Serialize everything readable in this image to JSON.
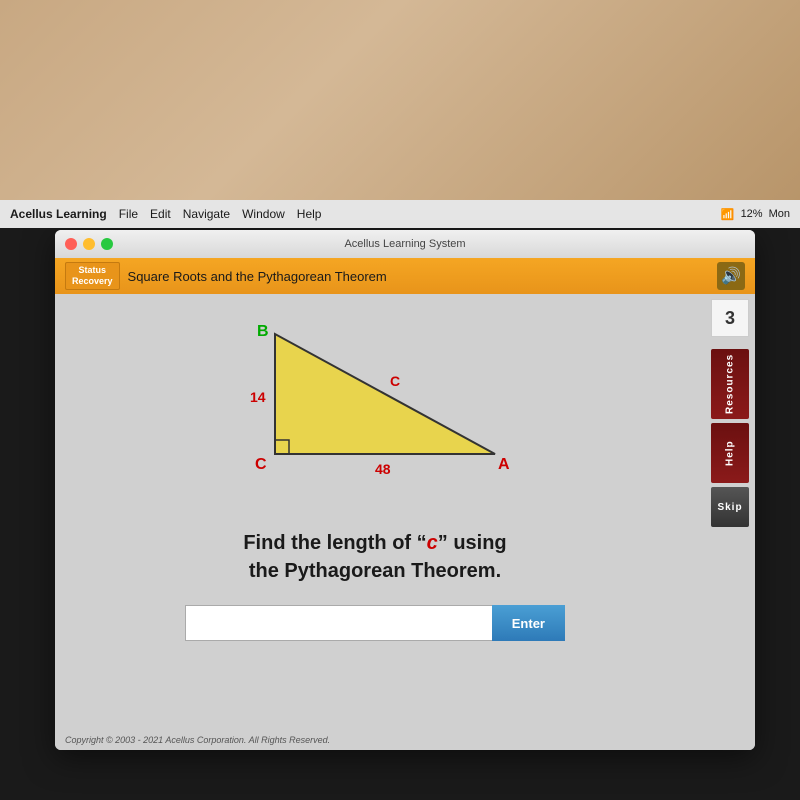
{
  "room": {
    "background_desc": "Room background with warm tan/brown walls"
  },
  "menubar": {
    "app_name": "Acellus Learning",
    "menu_items": [
      "File",
      "Edit",
      "Navigate",
      "Window",
      "Help"
    ],
    "status": "12%",
    "time": "Mon"
  },
  "window": {
    "title": "Acellus Learning System",
    "lesson_title": "Square Roots and the Pythagorean Theorem",
    "status_badge_line1": "Status",
    "status_badge_line2": "Recovery"
  },
  "sidebar": {
    "number": "3",
    "resources_label": "Resources",
    "help_label": "Help",
    "skip_label": "Skip"
  },
  "triangle": {
    "vertex_b": "B",
    "vertex_a": "A",
    "vertex_c": "C",
    "hypotenuse_label": "C",
    "side_14": "14",
    "side_48": "48"
  },
  "question": {
    "line1": "Find the length of “c” using",
    "line2": "the Pythagorean Theorem.",
    "highlight_word": "c"
  },
  "input": {
    "placeholder": "",
    "enter_label": "Enter"
  },
  "copyright": "Copyright © 2003 - 2021 Acellus Corporation.  All Rights Reserved."
}
